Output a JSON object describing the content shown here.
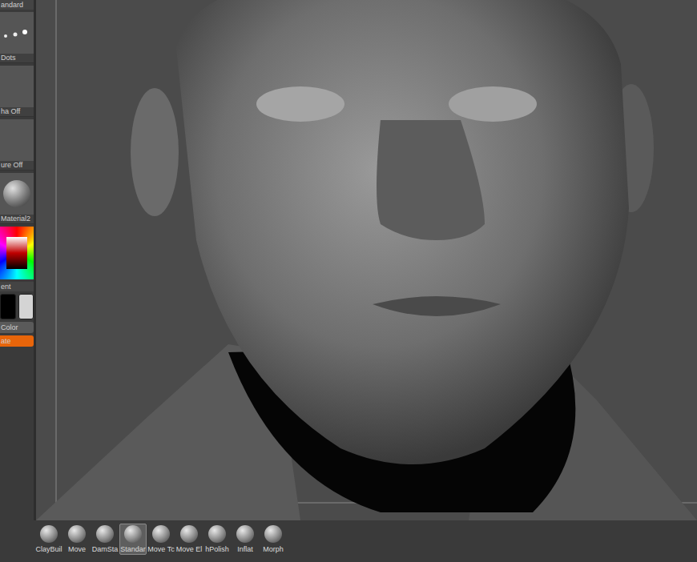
{
  "left_panel": [
    {
      "kind": "label",
      "text": "andard"
    },
    {
      "kind": "dots",
      "text": "Dots"
    },
    {
      "kind": "blank",
      "text": "ha Off"
    },
    {
      "kind": "blank",
      "text": "ure Off"
    },
    {
      "kind": "material",
      "text": "Material2"
    },
    {
      "kind": "picker",
      "text": ""
    },
    {
      "kind": "label",
      "text": "ent"
    },
    {
      "kind": "swatches",
      "text": "",
      "colors": [
        "#000000",
        "#d4d4d4"
      ]
    },
    {
      "kind": "button",
      "text": "Color",
      "active": false
    },
    {
      "kind": "button",
      "text": "ate",
      "active": true
    }
  ],
  "brushes": [
    {
      "label": "ClayBuil",
      "selected": false
    },
    {
      "label": "Move",
      "selected": false
    },
    {
      "label": "DamSta",
      "selected": false
    },
    {
      "label": "Standar",
      "selected": true
    },
    {
      "label": "Move Tc",
      "selected": false
    },
    {
      "label": "Move El",
      "selected": false
    },
    {
      "label": "hPolish",
      "selected": false
    },
    {
      "label": "Inflat",
      "selected": false
    },
    {
      "label": "Morph",
      "selected": false
    }
  ]
}
